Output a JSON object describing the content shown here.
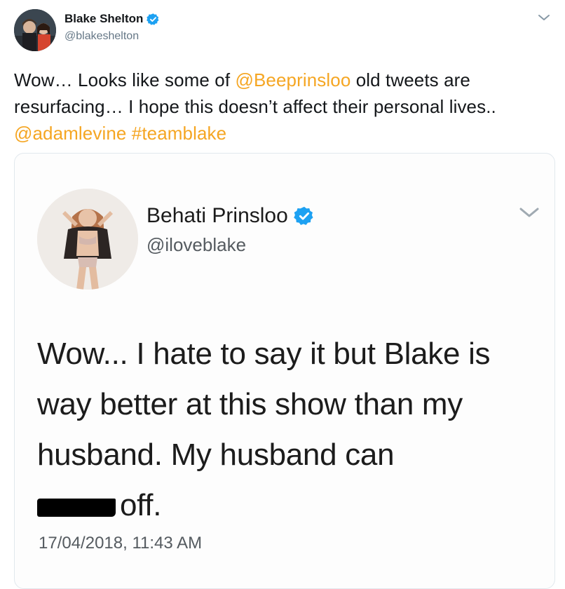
{
  "author": {
    "name": "Blake Shelton",
    "handle": "@blakeshelton",
    "verified": true
  },
  "tweet": {
    "segments": [
      {
        "text": "Wow… Looks like some of ",
        "link": false
      },
      {
        "text": "@Beeprinsloo",
        "link": true
      },
      {
        "text": " old tweets are resurfacing… I hope this doesn’t affect their personal lives.. ",
        "link": false
      },
      {
        "text": "@adamlevine",
        "link": true
      },
      {
        "text": " ",
        "link": false
      },
      {
        "text": "#teamblake",
        "link": true
      }
    ]
  },
  "embedded": {
    "name": "Behati Prinsloo",
    "handle": "@iloveblake",
    "verified": true,
    "text_before": "Wow... I hate to say it but Blake is way better at this show than my husband. My husband can",
    "text_after": "off.",
    "timestamp": "17/04/2018, 11:43 AM"
  },
  "colors": {
    "link": "#f5a623",
    "verified": "#1da1f2",
    "secondary_text": "#657786"
  },
  "icons": {
    "menu": "chevron-down-icon",
    "verified": "verified-badge-icon"
  }
}
